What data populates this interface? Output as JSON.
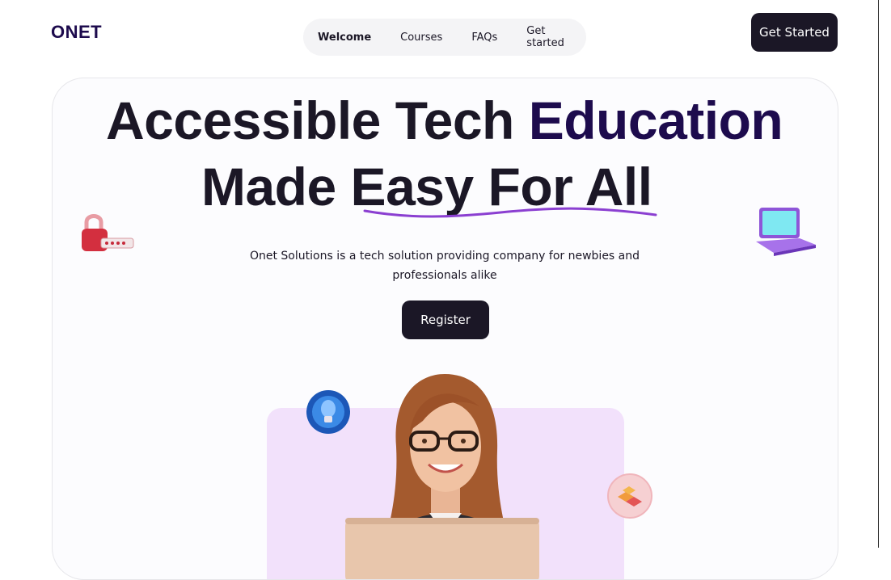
{
  "header": {
    "logo": "ONET",
    "nav": [
      {
        "label": "Welcome",
        "active": true
      },
      {
        "label": "Courses",
        "active": false
      },
      {
        "label": "FAQs",
        "active": false
      },
      {
        "label": "Get started",
        "active": false
      }
    ],
    "cta_label": "Get Started"
  },
  "hero": {
    "title_part1": "Accessible Tech ",
    "title_accent": "Education",
    "title_part2": "Made ",
    "title_part3": "Easy For All",
    "description": "Onet Solutions is a tech solution providing company for newbies and professionals alike",
    "register_label": "Register"
  },
  "colors": {
    "brand_dark": "#1b1726",
    "brand_purple": "#1d0b4d",
    "underline": "#8b3fd1",
    "panel_bg": "#f2e1fb"
  },
  "icons": [
    "padlock-password-icon",
    "laptop-icon",
    "lightbulb-badge-icon",
    "blocks-badge-icon"
  ]
}
